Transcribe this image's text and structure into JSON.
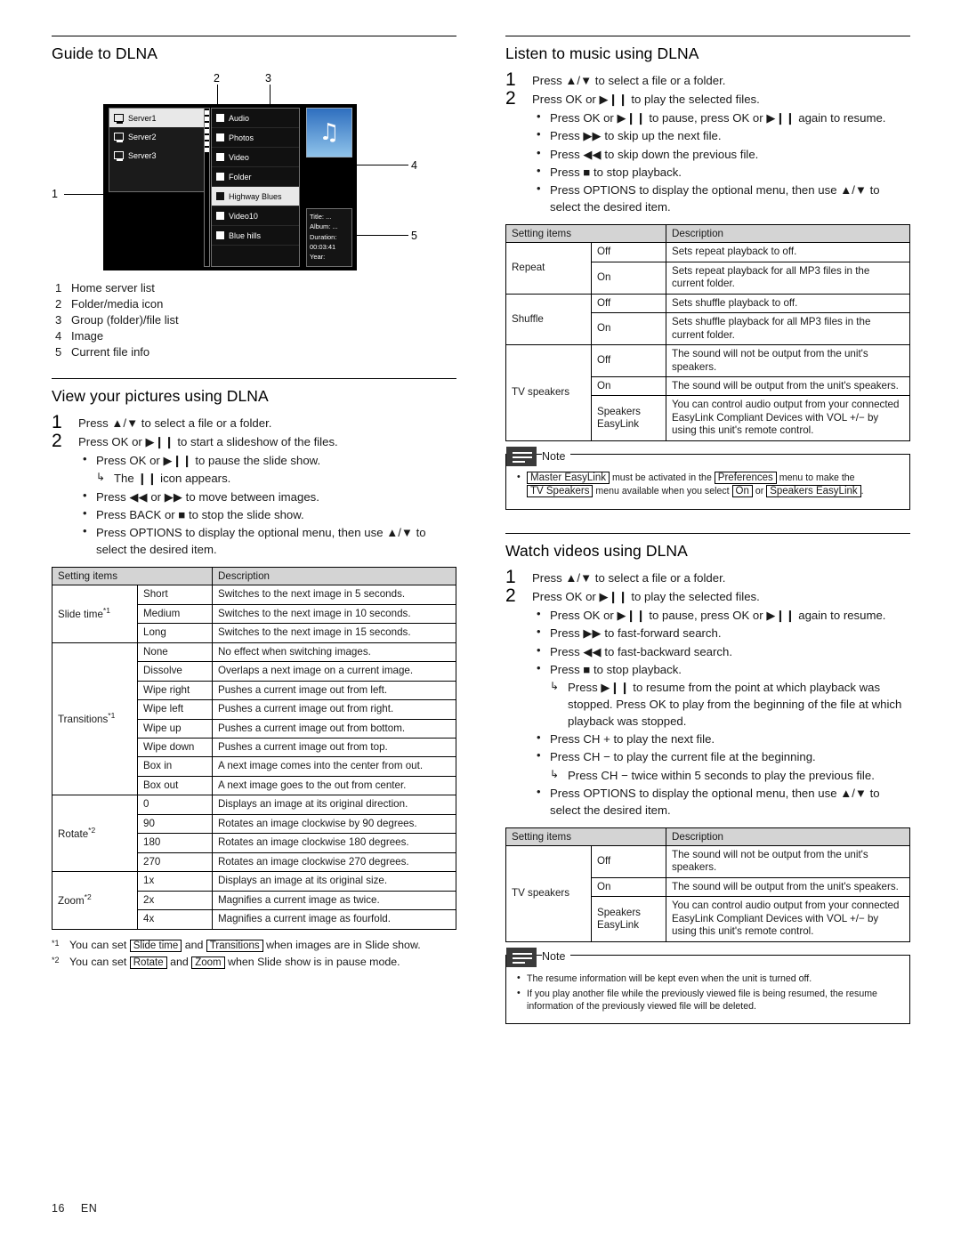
{
  "page": {
    "number": "16",
    "lang": "EN"
  },
  "left": {
    "section1": {
      "title": "Guide to DLNA",
      "screenshot": {
        "callouts": [
          "1",
          "2",
          "3",
          "4",
          "5"
        ],
        "servers": [
          "Server1",
          "Server2",
          "Server3"
        ],
        "folders": [
          "Audio",
          "Photos",
          "Video",
          "Folder",
          "Highway Blues",
          "Video10",
          "Blue hills"
        ],
        "info": {
          "title_label": "Title:",
          "title_value": "...",
          "album_label": "Album:",
          "album_value": "...",
          "duration_label": "Duration: 00:03:41",
          "year_label": "Year:"
        }
      },
      "legend": [
        {
          "n": "1",
          "text": "Home server list"
        },
        {
          "n": "2",
          "text": "Folder/media icon"
        },
        {
          "n": "3",
          "text": "Group (folder)/file list"
        },
        {
          "n": "4",
          "text": "Image"
        },
        {
          "n": "5",
          "text": "Current file info"
        }
      ]
    },
    "section2": {
      "title": "View your pictures using DLNA",
      "step1": "Press ▲/▼ to select a file or a folder.",
      "step2": "Press OK or ▶❙❙ to start a slideshow of the files.",
      "bullets": [
        {
          "text": "Press OK or ▶❙❙ to pause the slide show.",
          "sub": "The ❙❙ icon appears."
        },
        {
          "text": "Press ◀◀ or ▶▶ to move between images."
        },
        {
          "text": "Press BACK or ■ to stop the slide show."
        },
        {
          "text": "Press OPTIONS to display the optional menu, then use ▲/▼ to select the desired item."
        }
      ],
      "table": {
        "headers": [
          "Setting items",
          "",
          "Description"
        ],
        "rows": [
          {
            "item": "Slide time",
            "sup": "*1",
            "values": [
              {
                "value": "Short",
                "desc": "Switches to the next image in 5 seconds."
              },
              {
                "value": "Medium",
                "desc": "Switches to the next image in 10 seconds."
              },
              {
                "value": "Long",
                "desc": "Switches to the next image in 15 seconds."
              }
            ]
          },
          {
            "item": "Transitions",
            "sup": "*1",
            "values": [
              {
                "value": "None",
                "desc": "No effect when switching images."
              },
              {
                "value": "Dissolve",
                "desc": "Overlaps a next image on a current image."
              },
              {
                "value": "Wipe right",
                "desc": "Pushes a current image out from left."
              },
              {
                "value": "Wipe left",
                "desc": "Pushes a current image out from right."
              },
              {
                "value": "Wipe up",
                "desc": "Pushes a current image out from bottom."
              },
              {
                "value": "Wipe down",
                "desc": "Pushes a current image out from top."
              },
              {
                "value": "Box in",
                "desc": "A next image comes into the center from out."
              },
              {
                "value": "Box out",
                "desc": "A next image goes to the out from center."
              }
            ]
          },
          {
            "item": "Rotate",
            "sup": "*2",
            "values": [
              {
                "value": "0",
                "desc": "Displays an image at its original direction."
              },
              {
                "value": "90",
                "desc": "Rotates an image clockwise by 90 degrees."
              },
              {
                "value": "180",
                "desc": "Rotates an image clockwise 180 degrees."
              },
              {
                "value": "270",
                "desc": "Rotates an image clockwise 270 degrees."
              }
            ]
          },
          {
            "item": "Zoom",
            "sup": "*2",
            "values": [
              {
                "value": "1x",
                "desc": "Displays an image at its original size."
              },
              {
                "value": "2x",
                "desc": "Magnifies a current image as twice."
              },
              {
                "value": "4x",
                "desc": "Magnifies a current image as fourfold."
              }
            ]
          }
        ]
      },
      "footnotes": [
        {
          "mark": "*1",
          "pre": "You can set ",
          "k1": "Slide time",
          "mid": " and ",
          "k2": "Transitions",
          "post": " when images are in Slide show."
        },
        {
          "mark": "*2",
          "pre": "You can set ",
          "k1": "Rotate",
          "mid": " and ",
          "k2": "Zoom",
          "post": " when Slide show is in pause mode."
        }
      ]
    }
  },
  "right": {
    "section1": {
      "title": "Listen to music using DLNA",
      "step1": "Press ▲/▼ to select a file or a folder.",
      "step2": "Press OK or ▶❙❙ to play the selected files.",
      "bullets": [
        {
          "text": "Press OK or ▶❙❙ to pause, press OK or ▶❙❙ again to resume."
        },
        {
          "text": "Press ▶▶ to skip up the next file."
        },
        {
          "text": "Press ◀◀ to skip down the previous file."
        },
        {
          "text": "Press ■ to stop playback."
        },
        {
          "text": "Press OPTIONS to display the optional menu, then use ▲/▼ to select the desired item."
        }
      ],
      "table": {
        "headers": [
          "Setting items",
          "",
          "Description"
        ],
        "rows": [
          {
            "item": "Repeat",
            "values": [
              {
                "value": "Off",
                "desc": "Sets repeat playback to off."
              },
              {
                "value": "On",
                "desc": "Sets repeat playback for all MP3 files in the current folder."
              }
            ]
          },
          {
            "item": "Shuffle",
            "values": [
              {
                "value": "Off",
                "desc": "Sets shuffle playback to off."
              },
              {
                "value": "On",
                "desc": "Sets shuffle playback for all MP3 files in the current folder."
              }
            ]
          },
          {
            "item": "TV speakers",
            "values": [
              {
                "value": "Off",
                "desc": "The sound will not be output from the unit's speakers."
              },
              {
                "value": "On",
                "desc": "The sound will be output from the unit's speakers."
              },
              {
                "value": "Speakers EasyLink",
                "desc": "You can control audio output from your connected EasyLink Compliant Devices with VOL +/− by using this unit's remote control."
              }
            ]
          }
        ]
      },
      "note": {
        "label": "Note",
        "items": [
          {
            "k1": "Master EasyLink",
            "t1": " must be activated in the ",
            "k2": "Preferences",
            "t2": " menu to make the ",
            "k3": "TV Speakers",
            "t3": " menu available when you select ",
            "k4": "On",
            "t4": " or ",
            "k5": "Speakers EasyLink",
            "t5": "."
          }
        ]
      }
    },
    "section2": {
      "title": "Watch videos using DLNA",
      "step1": "Press ▲/▼ to select a file or a folder.",
      "step2": "Press OK or ▶❙❙ to play the selected files.",
      "bullets": [
        {
          "text": "Press OK or ▶❙❙ to pause, press OK or ▶❙❙ again to resume."
        },
        {
          "text": "Press ▶▶ to fast-forward search."
        },
        {
          "text": "Press ◀◀ to fast-backward search."
        },
        {
          "text": "Press ■ to stop playback.",
          "sub": "Press ▶❙❙ to resume from the point at which playback was stopped. Press OK to play from the beginning of the file at which playback was stopped."
        },
        {
          "text": "Press CH + to play the next file."
        },
        {
          "text": "Press CH − to play the current file at the beginning.",
          "sub": "Press CH − twice within 5 seconds to play the previous file."
        },
        {
          "text": "Press OPTIONS to display the optional menu, then use ▲/▼ to select the desired item."
        }
      ],
      "table": {
        "headers": [
          "Setting items",
          "",
          "Description"
        ],
        "rows": [
          {
            "item": "TV speakers",
            "values": [
              {
                "value": "Off",
                "desc": "The sound will not be output from the unit's speakers."
              },
              {
                "value": "On",
                "desc": "The sound will be output from the unit's speakers."
              },
              {
                "value": "Speakers EasyLink",
                "desc": "You can control audio output from your connected EasyLink Compliant Devices with VOL +/− by using this unit's remote control."
              }
            ]
          }
        ]
      },
      "note": {
        "label": "Note",
        "items": [
          {
            "t1": "The resume information will be kept even when the unit is turned off."
          },
          {
            "t1": "If you play another file while the previously viewed file is being resumed, the resume information of the previously viewed file will be deleted."
          }
        ]
      }
    }
  }
}
